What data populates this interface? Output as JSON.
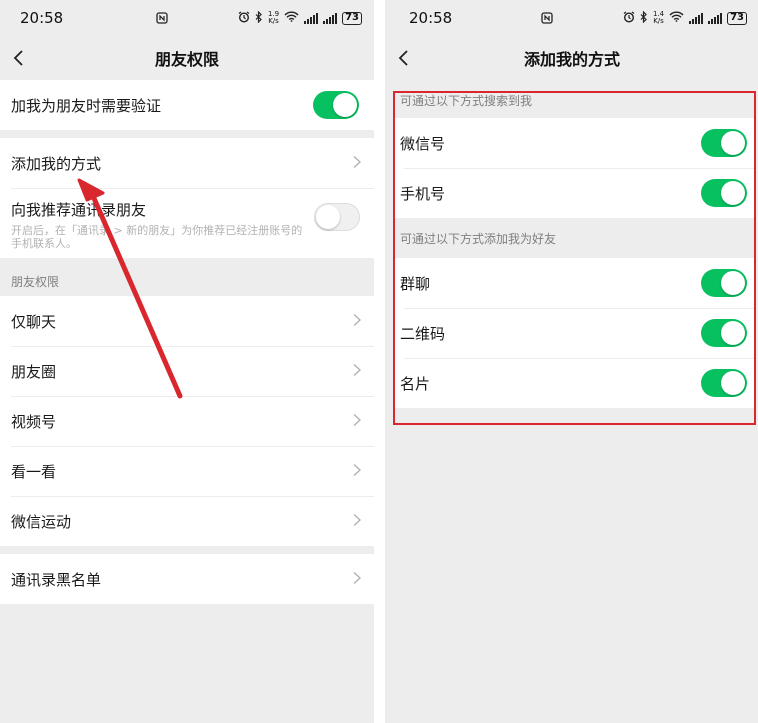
{
  "status_bar": {
    "time": "20:58",
    "left_speed_value": "1.9",
    "right_speed_value": "1.4",
    "speed_unit": "K/s",
    "battery": "73"
  },
  "left": {
    "title": "朋友权限",
    "verify": {
      "label": "加我为朋友时需要验证",
      "on": true
    },
    "add_methods_label": "添加我的方式",
    "recommend": {
      "label": "向我推荐通讯录朋友",
      "desc": "开启后，在「通讯录 > 新的朋友」为你推荐已经注册账号的手机联系人。",
      "on": false
    },
    "friend_perm_header": "朋友权限",
    "perm_items": [
      {
        "label": "仅聊天"
      },
      {
        "label": "朋友圈"
      },
      {
        "label": "视频号"
      },
      {
        "label": "看一看"
      },
      {
        "label": "微信运动"
      }
    ],
    "blacklist_label": "通讯录黑名单"
  },
  "right": {
    "title": "添加我的方式",
    "search_header": "可通过以下方式搜索到我",
    "search_items": [
      {
        "label": "微信号",
        "on": true
      },
      {
        "label": "手机号",
        "on": true
      }
    ],
    "add_header": "可通过以下方式添加我为好友",
    "add_items": [
      {
        "label": "群聊",
        "on": true
      },
      {
        "label": "二维码",
        "on": true
      },
      {
        "label": "名片",
        "on": true
      }
    ]
  },
  "colors": {
    "toggle_on": "#07c160",
    "annotation_red": "#d9272e",
    "background": "#ededed"
  }
}
